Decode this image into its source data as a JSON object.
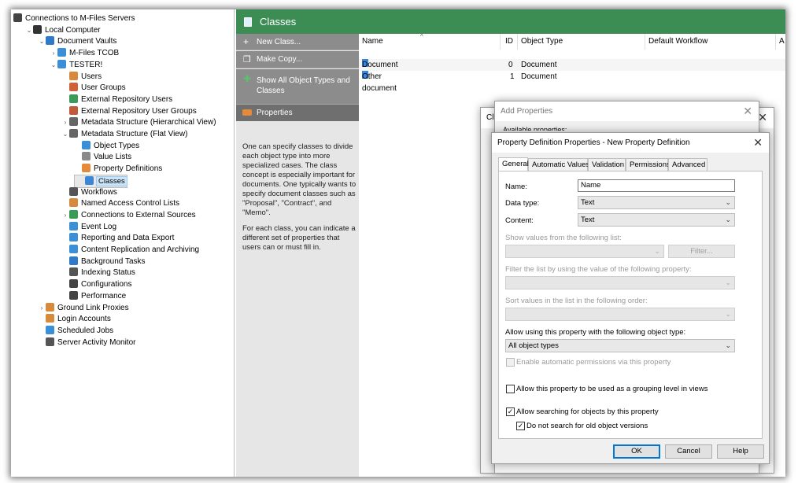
{
  "tree": {
    "items": [
      {
        "label": "Connections to M-Files Servers",
        "icon": "servers-icon",
        "color": "#444444",
        "level": 0,
        "twisty": ""
      },
      {
        "label": "Local Computer",
        "icon": "computer-icon",
        "color": "#333333",
        "level": 1,
        "twisty": "⌄"
      },
      {
        "label": "Document Vaults",
        "icon": "vaults-icon",
        "color": "#2f79c8",
        "level": 2,
        "twisty": "⌄"
      },
      {
        "label": "M-Files TCOB",
        "icon": "vault-icon",
        "color": "#3b8fd6",
        "level": 3,
        "twisty": "›"
      },
      {
        "label": "TESTER!",
        "icon": "vault-icon",
        "color": "#3b8fd6",
        "level": 3,
        "twisty": "⌄"
      },
      {
        "label": "Users",
        "icon": "user-icon",
        "color": "#d88a3c",
        "level": 4,
        "twisty": ""
      },
      {
        "label": "User Groups",
        "icon": "user-groups-icon",
        "color": "#d0603a",
        "level": 4,
        "twisty": ""
      },
      {
        "label": "External Repository Users",
        "icon": "external-user-icon",
        "color": "#3a9a58",
        "level": 4,
        "twisty": ""
      },
      {
        "label": "External Repository User Groups",
        "icon": "external-groups-icon",
        "color": "#c05a3a",
        "level": 4,
        "twisty": ""
      },
      {
        "label": "Metadata Structure (Hierarchical View)",
        "icon": "hierarchy-icon",
        "color": "#666666",
        "level": 4,
        "twisty": "›"
      },
      {
        "label": "Metadata Structure (Flat View)",
        "icon": "flat-list-icon",
        "color": "#666666",
        "level": 4,
        "twisty": "⌄"
      },
      {
        "label": "Object Types",
        "icon": "object-types-icon",
        "color": "#3b8fd6",
        "level": 5,
        "twisty": ""
      },
      {
        "label": "Value Lists",
        "icon": "value-lists-icon",
        "color": "#8a8a8a",
        "level": 5,
        "twisty": ""
      },
      {
        "label": "Property Definitions",
        "icon": "property-icon",
        "color": "#e48a3a",
        "level": 5,
        "twisty": ""
      },
      {
        "label": "Classes",
        "icon": "classes-icon",
        "color": "#3b86d6",
        "level": 5,
        "twisty": "",
        "selected": true
      },
      {
        "label": "Workflows",
        "icon": "workflow-icon",
        "color": "#555555",
        "level": 4,
        "twisty": ""
      },
      {
        "label": "Named Access Control Lists",
        "icon": "acl-icon",
        "color": "#d88a3c",
        "level": 4,
        "twisty": ""
      },
      {
        "label": "Connections to External Sources",
        "icon": "connection-icon",
        "color": "#3a9a58",
        "level": 4,
        "twisty": "›"
      },
      {
        "label": "Event Log",
        "icon": "event-log-icon",
        "color": "#3b8fd6",
        "level": 4,
        "twisty": ""
      },
      {
        "label": "Reporting and Data Export",
        "icon": "report-icon",
        "color": "#3b8fd6",
        "level": 4,
        "twisty": ""
      },
      {
        "label": "Content Replication and Archiving",
        "icon": "replication-icon",
        "color": "#3b8fd6",
        "level": 4,
        "twisty": ""
      },
      {
        "label": "Background Tasks",
        "icon": "background-tasks-icon",
        "color": "#2f79c8",
        "level": 4,
        "twisty": ""
      },
      {
        "label": "Indexing Status",
        "icon": "indexing-icon",
        "color": "#555555",
        "level": 4,
        "twisty": ""
      },
      {
        "label": "Configurations",
        "icon": "gear-icon",
        "color": "#444444",
        "level": 4,
        "twisty": ""
      },
      {
        "label": "Performance",
        "icon": "performance-icon",
        "color": "#444444",
        "level": 4,
        "twisty": ""
      },
      {
        "label": "Ground Link Proxies",
        "icon": "proxy-icon",
        "color": "#d88a3c",
        "level": 2,
        "twisty": "›"
      },
      {
        "label": "Login Accounts",
        "icon": "login-icon",
        "color": "#d88a3c",
        "level": 2,
        "twisty": ""
      },
      {
        "label": "Scheduled Jobs",
        "icon": "scheduled-jobs-icon",
        "color": "#3b8fd6",
        "level": 2,
        "twisty": ""
      },
      {
        "label": "Server Activity Monitor",
        "icon": "monitor-icon",
        "color": "#555555",
        "level": 2,
        "twisty": ""
      }
    ]
  },
  "main": {
    "title": "Classes",
    "title_icon": "classes-icon",
    "accent": "#3c8d54",
    "tasks": [
      {
        "label": "New Class...",
        "icon": "plus-icon",
        "glyph": "+"
      },
      {
        "label": "Make Copy...",
        "icon": "copy-icon",
        "glyph": "❐"
      },
      {
        "label": "Show All Object Types and Classes",
        "icon": "show-all-icon",
        "glyph": "✚"
      }
    ],
    "properties_header": "Properties",
    "description": [
      "One can specify classes to divide each object type into more specialized cases. The class concept is especially important for documents. One typically wants to specify document classes such as \"Proposal\", \"Contract\", and \"Memo\".",
      "For each class, you can indicate a different set of properties that users can or must fill in."
    ],
    "columns": [
      "Name",
      "ID",
      "Object Type",
      "Default Workflow",
      "A"
    ],
    "rows": [
      {
        "name": "Document",
        "id": "0",
        "object_type": "Document"
      },
      {
        "name": "Other document",
        "id": "1",
        "object_type": "Document"
      }
    ]
  },
  "bg_dialogs": {
    "add_properties_title": "Add Properties",
    "add_properties_label": "Available properties:",
    "other_title": "Cl"
  },
  "dialog": {
    "title": "Property Definition Properties - New Property Definition",
    "tabs": [
      "General",
      "Automatic Values",
      "Validation",
      "Permissions",
      "Advanced"
    ],
    "active_tab": "General",
    "name_label": "Name:",
    "name_value": "Name",
    "datatype_label": "Data type:",
    "datatype_value": "Text",
    "content_label": "Content:",
    "content_value": "Text",
    "show_values_label": "Show values from the following list:",
    "filter_button": "Filter...",
    "filter_list_label": "Filter the list by using the value of the following property:",
    "sort_label": "Sort values in the list in the following order:",
    "allow_objtype_label": "Allow using this property with the following object type:",
    "objtype_value": "All object types",
    "auto_perm_label": "Enable automatic permissions via this property",
    "grouping_label": "Allow this property to be used as a grouping level in views",
    "searching_label": "Allow searching for objects by this property",
    "old_versions_label": "Do not search for old object versions",
    "searching_checked": true,
    "old_versions_checked": true,
    "grouping_checked": false,
    "ok": "OK",
    "cancel": "Cancel",
    "help": "Help"
  }
}
